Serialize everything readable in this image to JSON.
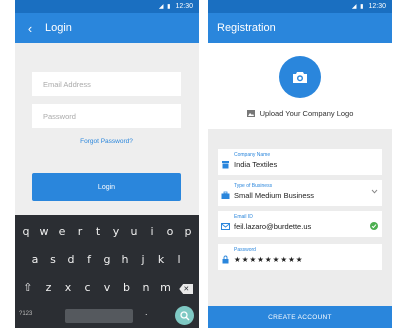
{
  "status": {
    "time": "12:30"
  },
  "login": {
    "title": "Login",
    "email_placeholder": "Email Address",
    "password_placeholder": "Password",
    "forgot_label": "Forgot Password?",
    "login_label": "Login"
  },
  "keyboard": {
    "row1": [
      "q",
      "w",
      "e",
      "r",
      "t",
      "y",
      "u",
      "i",
      "o",
      "p"
    ],
    "row2": [
      "a",
      "s",
      "d",
      "f",
      "g",
      "h",
      "j",
      "k",
      "l"
    ],
    "row3": [
      "z",
      "x",
      "c",
      "v",
      "b",
      "n",
      "m"
    ],
    "symbols": "?123",
    "period": "."
  },
  "registration": {
    "title": "Registration",
    "upload_label": "Upload Your Company Logo",
    "fields": [
      {
        "label": "Company Name",
        "value": "India Textiles"
      },
      {
        "label": "Type of Business",
        "value": "Small Medium Business"
      },
      {
        "label": "Email ID",
        "value": "feil.lazaro@burdette.us"
      },
      {
        "label": "Password",
        "value": "★★★★★★★★★"
      }
    ],
    "create_label": "CREATE ACCOUNT"
  },
  "colors": {
    "primary": "#2a86dc",
    "statusbar": "#1a6fc1",
    "success": "#4caf50",
    "keyboard": "#2b2e33"
  },
  "icons": [
    "back-arrow-icon",
    "camera-icon",
    "image-icon",
    "store-icon",
    "briefcase-icon",
    "mail-icon",
    "lock-icon",
    "chevron-down-icon",
    "check-icon",
    "backspace-icon",
    "shift-icon",
    "search-icon"
  ]
}
